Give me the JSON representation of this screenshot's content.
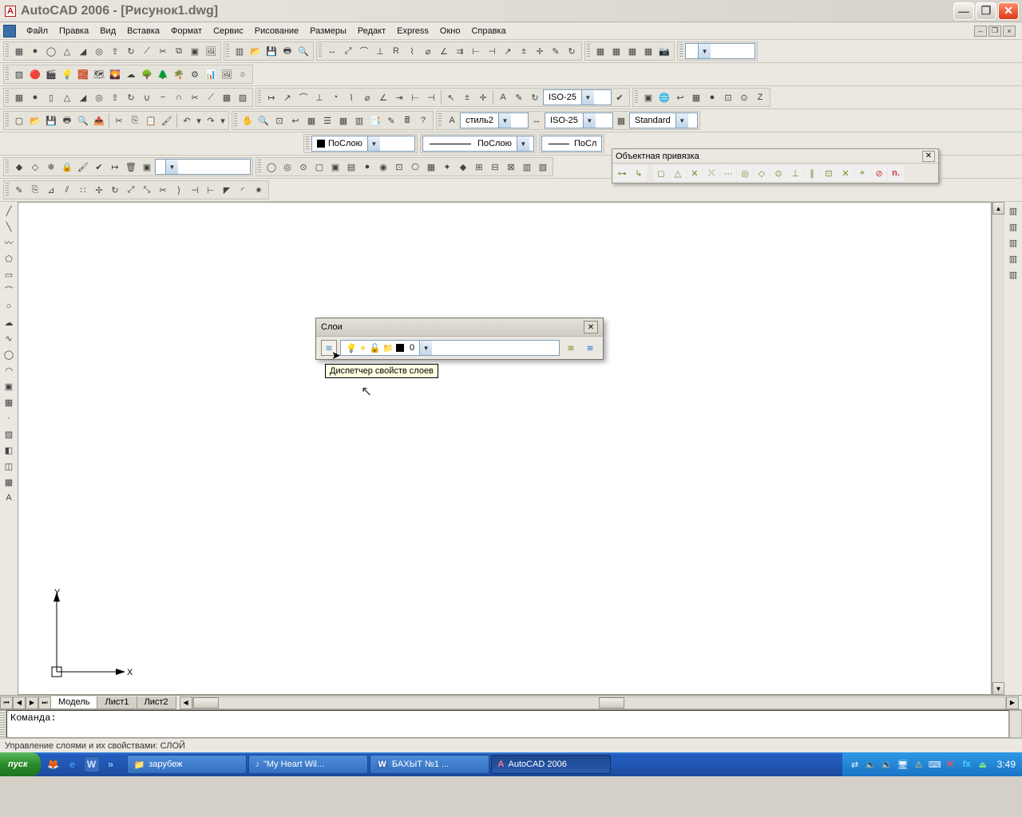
{
  "title": "AutoCAD 2006 - [Рисунок1.dwg]",
  "menu": [
    "Файл",
    "Правка",
    "Вид",
    "Вставка",
    "Формат",
    "Сервис",
    "Рисование",
    "Размеры",
    "Редакт",
    "Express",
    "Окно",
    "Справка"
  ],
  "combos": {
    "dimstyle1": "ISO-25",
    "textstyle": "стиль2",
    "dimstyle2": "ISO-25",
    "standard": "Standard",
    "color": "ПоСлою",
    "ltype": "ПоСлою",
    "lweight": "ПоСл",
    "layer_filter": ""
  },
  "osnap": {
    "title": "Объектная привязка"
  },
  "layers_panel": {
    "title": "Слои",
    "current": "0",
    "tooltip": "Диспетчер свойств слоев"
  },
  "tabs": [
    "Модель",
    "Лист1",
    "Лист2"
  ],
  "ucs": {
    "x": "X",
    "y": "Y"
  },
  "command_prompt": "Команда:",
  "status": "Управление слоями и их свойствами:  СЛОЙ",
  "taskbar": {
    "start": "пуск",
    "items": [
      "зарубеж",
      "\"My Heart Wil...",
      "БАХЫТ №1 ...",
      "AutoCAD 2006"
    ],
    "clock": "3:49"
  }
}
